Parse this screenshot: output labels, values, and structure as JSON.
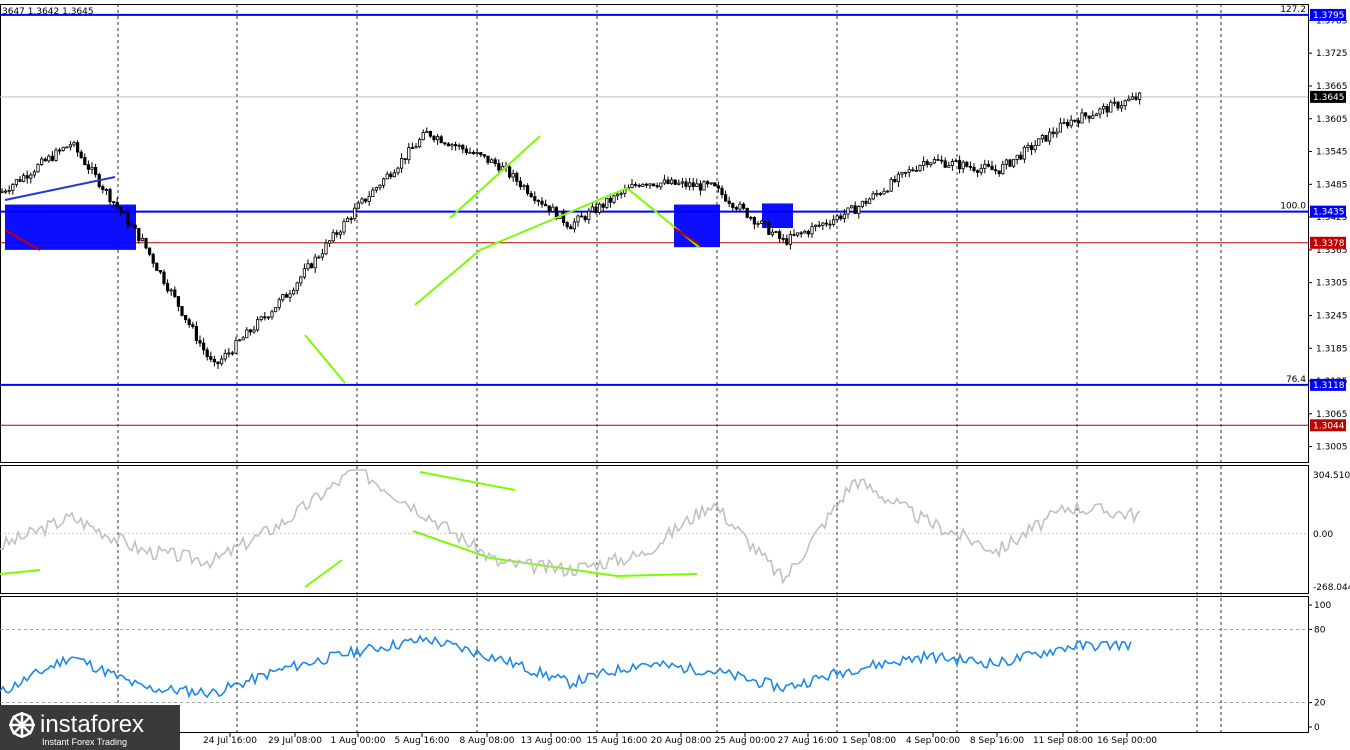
{
  "header": {
    "ohlc_text": "3647 1.3642 1.3645"
  },
  "colors": {
    "candle": "#000000",
    "hline_blue": "#0000ff",
    "hline_red": "#c00000",
    "box_blue": "#0000ff",
    "trend_green": "#7cfc00",
    "trend_blue": "#1e3adc",
    "trend_red": "#c00000",
    "cci": "#c0c0c0",
    "rsi": "#1e88e5",
    "grid_vertical": "#000000",
    "price_line": "#c0c0c0"
  },
  "price_axis": {
    "ticks": [
      "1.3785",
      "1.3725",
      "1.3665",
      "1.3605",
      "1.3545",
      "1.3485",
      "1.3425",
      "1.3365",
      "1.3305",
      "1.3245",
      "1.3185",
      "1.3125",
      "1.3065",
      "1.3005"
    ],
    "current_price": "1.3645",
    "levels": [
      {
        "value": "1.3795",
        "fib": "127.2",
        "color": "blue"
      },
      {
        "value": "1.3435",
        "fib": "100.0",
        "color": "blue"
      },
      {
        "value": "1.3378",
        "fib": "",
        "color": "red"
      },
      {
        "value": "1.3118",
        "fib": "76.4",
        "color": "blue"
      },
      {
        "value": "1.3044",
        "fib": "",
        "color": "red"
      }
    ]
  },
  "cci_axis": {
    "max": "304.5101",
    "zero": "0.00",
    "min": "-268.0446"
  },
  "rsi_axis": {
    "levels": [
      "100",
      "80",
      "20",
      "0"
    ]
  },
  "time_axis": [
    "24 Jul 16:00",
    "29 Jul 08:00",
    "1 Aug 00:00",
    "5 Aug 16:00",
    "8 Aug 08:00",
    "13 Aug 00:00",
    "15 Aug 16:00",
    "20 Aug 08:00",
    "25 Aug 00:00",
    "27 Aug 16:00",
    "1 Sep 08:00",
    "4 Sep 00:00",
    "8 Sep 16:00",
    "11 Sep 08:00",
    "16 Sep 00:00"
  ],
  "logo": {
    "brand": "instaforex",
    "tagline": "Instant Forex Trading"
  },
  "chart_data": [
    {
      "type": "candlestick",
      "title": "",
      "ylim": [
        1.2975,
        1.3815
      ],
      "horizontal_levels": [
        1.3795,
        1.3435,
        1.3378,
        1.3118,
        1.3044
      ],
      "close_path_x": [
        "start",
        "24 Jul 16:00",
        "29 Jul 08:00",
        "1 Aug 00:00",
        "5 Aug 16:00",
        "8 Aug 08:00",
        "13 Aug 00:00",
        "15 Aug 16:00",
        "20 Aug 08:00",
        "25 Aug 00:00",
        "27 Aug 16:00",
        "1 Sep 08:00",
        "4 Sep 00:00",
        "8 Sep 16:00",
        "11 Sep 08:00",
        "16 Sep 00:00",
        "end"
      ],
      "approx_close_path": [
        1.347,
        1.356,
        1.338,
        1.315,
        1.328,
        1.344,
        1.358,
        1.352,
        1.341,
        1.349,
        1.348,
        1.338,
        1.344,
        1.353,
        1.351,
        1.36,
        1.3645
      ],
      "current_price": 1.3645
    },
    {
      "type": "line",
      "name_hint": "CCI",
      "ylim": [
        -268.0446,
        304.5101
      ],
      "approx_values": [
        -60,
        80,
        -80,
        -130,
        60,
        310,
        90,
        -140,
        -170,
        -100,
        150,
        -220,
        260,
        60,
        -80,
        130,
        90
      ]
    },
    {
      "type": "line",
      "name_hint": "RSI",
      "ylim": [
        0,
        100
      ],
      "reference_lines": [
        80,
        20
      ],
      "approx_values": [
        28,
        58,
        32,
        28,
        48,
        62,
        72,
        56,
        36,
        52,
        46,
        32,
        48,
        58,
        52,
        66,
        68
      ]
    }
  ]
}
